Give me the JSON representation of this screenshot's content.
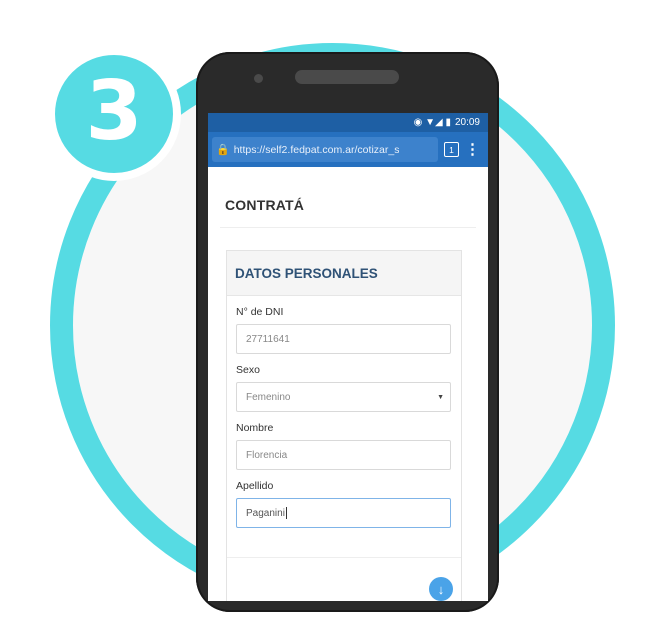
{
  "step": {
    "number": "3"
  },
  "status_bar": {
    "icons": "◉ ▼◢ ▮",
    "time": "20:09"
  },
  "browser": {
    "url": "https://self2.fedpat.com.ar/cotizar_s",
    "tab_count": "1",
    "menu_glyph": "⋮"
  },
  "page": {
    "title": "CONTRATÁ"
  },
  "form": {
    "section_title": "DATOS PERSONALES",
    "fields": [
      {
        "label": "N° de DNI",
        "value": "27711641"
      },
      {
        "label": "Sexo",
        "value": "Femenino"
      },
      {
        "label": "Nombre",
        "value": "Florencia"
      },
      {
        "label": "Apellido",
        "value": "Paganini"
      }
    ]
  },
  "colors": {
    "accent_ring": "#56dbe3",
    "browser_bar": "#2670bf",
    "fab": "#4aa3e8"
  }
}
